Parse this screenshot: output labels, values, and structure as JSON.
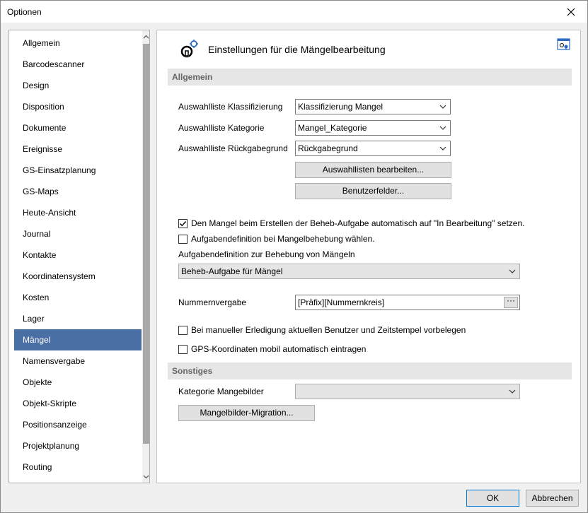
{
  "window": {
    "title": "Optionen"
  },
  "nav": {
    "items": [
      {
        "label": "Allgemein"
      },
      {
        "label": "Barcodescanner"
      },
      {
        "label": "Design"
      },
      {
        "label": "Disposition"
      },
      {
        "label": "Dokumente"
      },
      {
        "label": "Ereignisse"
      },
      {
        "label": "GS-Einsatzplanung"
      },
      {
        "label": "GS-Maps"
      },
      {
        "label": "Heute-Ansicht"
      },
      {
        "label": "Journal"
      },
      {
        "label": "Kontakte"
      },
      {
        "label": "Koordinatensystem"
      },
      {
        "label": "Kosten"
      },
      {
        "label": "Lager"
      },
      {
        "label": "Mängel"
      },
      {
        "label": "Namensvergabe"
      },
      {
        "label": "Objekte"
      },
      {
        "label": "Objekt-Skripte"
      },
      {
        "label": "Positionsanzeige"
      },
      {
        "label": "Projektplanung"
      },
      {
        "label": "Routing"
      }
    ],
    "selected": "Mängel"
  },
  "panel": {
    "title": "Einstellungen für die Mängelbearbeitung",
    "section_general": "Allgemein",
    "fields": {
      "klassifizierung": {
        "label": "Auswahlliste Klassifizierung",
        "value": "Klassifizierung Mangel"
      },
      "kategorie": {
        "label": "Auswahlliste Kategorie",
        "value": "Mangel_Kategorie"
      },
      "rueckgabe": {
        "label": "Auswahlliste Rückgabegrund",
        "value": "Rückgabegrund"
      }
    },
    "buttons": {
      "edit_lists": "Auswahllisten bearbeiten...",
      "user_fields": "Benutzerfelder..."
    },
    "checkboxes": {
      "auto_status": {
        "label": "Den Mangel beim Erstellen der Beheb-Aufgabe automatisch auf \"In Bearbeitung\" setzen.",
        "checked": true
      },
      "task_def": {
        "label": "Aufgabendefinition bei Mangelbehebung wählen.",
        "checked": false
      },
      "manual_done": {
        "label": "Bei manueller Erledigung aktuellen Benutzer und Zeitstempel vorbelegen",
        "checked": false
      },
      "gps": {
        "label": "GPS-Koordinaten mobil automatisch eintragen",
        "checked": false
      }
    },
    "task_def_label": "Aufgabendefinition zur Behebung von Mängeln",
    "task_def_value": "Beheb-Aufgabe für Mängel",
    "numbering": {
      "label": "Nummernvergabe",
      "value": "[Präfix][Nummernkreis]",
      "button": "···"
    },
    "section_other": "Sonstiges",
    "image_category": {
      "label": "Kategorie Mangebilder",
      "value": ""
    },
    "migration_button": "Mangelbilder-Migration..."
  },
  "footer": {
    "ok": "OK",
    "cancel": "Abbrechen"
  }
}
